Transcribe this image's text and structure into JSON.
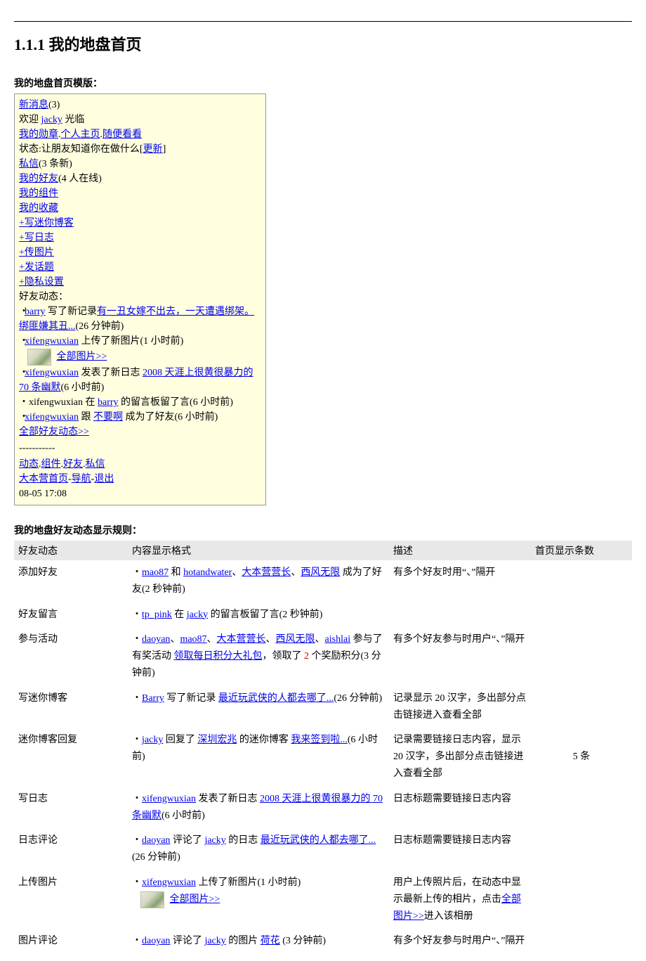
{
  "heading": "1.1.1 我的地盘首页",
  "labels": {
    "template": "我的地盘首页模版：",
    "rules": "我的地盘好友动态显示规则："
  },
  "template": {
    "newmsg_label": "新消息",
    "newmsg_count": "(3)",
    "welcome_prefix": "欢迎 ",
    "welcome_user": "jacky",
    "welcome_suffix": " 光临",
    "my_badge": "我的勋章",
    "my_home": "个人主页",
    "random_look": "随便看看",
    "status_label": "状态:让朋友知道你在做什么[",
    "status_update": "更新",
    "status_end": "]",
    "mail_label": "私信",
    "mail_count": "(3 条新)",
    "friends_label": "我的好友",
    "friends_count": "(4 人在线)",
    "modules": "我的组件",
    "favorites": "我的收藏",
    "write_mini": "+写迷你博客",
    "write_diary": "+写日志",
    "upload_pic": "+传图片",
    "post_topic": "+发话题",
    "privacy": "+隐私设置",
    "feed_label": "好友动态：",
    "item1_user": "barry",
    "item1_text1": " 写了新记录",
    "item1_link": "有一丑女嫁不出去，一天遭遇绑架。绑匪嫌其丑...",
    "item1_time": "(26 分钟前)",
    "item2_user": "xifengwuxian",
    "item2_text": "  上传了新图片(1 小时前)",
    "all_pics": "全部图片>>",
    "item3_user": "xifengwuxian",
    "item3_text1": "  发表了新日志  ",
    "item3_link": "2008 天涯上很黄很暴力的 70 条幽默",
    "item3_time": "(6 小时前)",
    "item4_pre": "・xifengwuxian  在  ",
    "item4_user": "barry",
    "item4_post": "  的留言板留了言(6 小时前)",
    "item5_user": "xifengwuxian",
    "item5_mid": "  跟  ",
    "item5_friend": "不要啊",
    "item5_post": "  成为了好友(6 小时前)",
    "all_feed": "全部好友动态>>",
    "dashes": "-----------",
    "nav_feed": "动态",
    "nav_modules": "组件",
    "nav_friends": "好友",
    "nav_mail": "私信",
    "nav_home": "大本营首页",
    "nav_sep": "-",
    "nav_guide": "导航",
    "nav_logout": "退出",
    "timestamp": "08-05 17:08"
  },
  "table": {
    "headers": [
      "好友动态",
      "内容显示格式",
      "描述",
      "首页显示条数"
    ],
    "count_value": "5 条",
    "rows": {
      "r1": {
        "c1": "添加好友",
        "u1": "mao87",
        "t1": " 和 ",
        "u2": "hotandwater",
        "u3": "大本营营长",
        "u4": "西风无限",
        "t2": "、",
        "t3": " 成为了好友(2 秒钟前)",
        "desc": "有多个好友时用“、”隔开"
      },
      "r2": {
        "c1": "好友留言",
        "u1": "tp_pink",
        "t1": "  在  ",
        "u2": "jacky",
        "t2": "  的留言板留了言(2 秒钟前)"
      },
      "r3": {
        "c1": "参与活动",
        "u1": "daoyan",
        "u2": "mao87",
        "u3": "大本营营长",
        "u4": "西风无限",
        "u5": "aishlai",
        "sep": "、",
        "t1": " 参与了有奖活动 ",
        "link": "领取每日积分大礼包",
        "t2": "，领取了 ",
        "red": "2",
        "t3": " 个奖励积分(3 分钟前)",
        "desc": "有多个好友参与时用户“、”隔开"
      },
      "r4": {
        "c1": "写迷你博客",
        "u1": "Barry",
        "t1": " 写了新记录  ",
        "link": "最近玩武侠的人都去哪了...",
        "time": "(26 分钟前)",
        "desc": "记录显示 20 汉字，多出部分点击链接进入查看全部"
      },
      "r5": {
        "c1": "迷你博客回复",
        "u1": "jacky",
        "t1": "  回复了  ",
        "u2": "深圳宏兆",
        "t2": " 的迷你博客 ",
        "link": "我来签到啦...",
        "time": "(6 小时前)",
        "desc": "记录需要链接日志内容，显示 20 汉字，多出部分点击链接进入查看全部"
      },
      "r6": {
        "c1": "写日志",
        "u1": "xifengwuxian",
        "t1": "  发表了新日志  ",
        "link": "2008 天涯上很黄很暴力的 70 条幽默",
        "time": "(6 小时前)",
        "desc": "日志标题需要链接日志内容"
      },
      "r7": {
        "c1": "日志评论",
        "u1": "daoyan",
        "t1": " 评论了 ",
        "u2": "jacky",
        "t2": "  的日志  ",
        "link": "最近玩武侠的人都去哪了...",
        "time": "(26 分钟前)",
        "desc": "日志标题需要链接日志内容"
      },
      "r8": {
        "c1": "上传图片",
        "u1": "xifengwuxian",
        "t1": "  上传了新图片(1 小时前)",
        "all_pics": "全部图片>>",
        "desc_pre": "用户上传照片后，在动态中显示最新上传的相片，点击",
        "desc_link": "全部图片>>",
        "desc_post": "进入该相册"
      },
      "r9": {
        "c1": "图片评论",
        "u1": "daoyan",
        "t1": " 评论了 ",
        "u2": "jacky",
        "t2": "  的图片  ",
        "link": "荷花",
        "time": "  (3 分钟前)",
        "desc": "有多个好友参与时用户“、”隔开"
      }
    }
  }
}
